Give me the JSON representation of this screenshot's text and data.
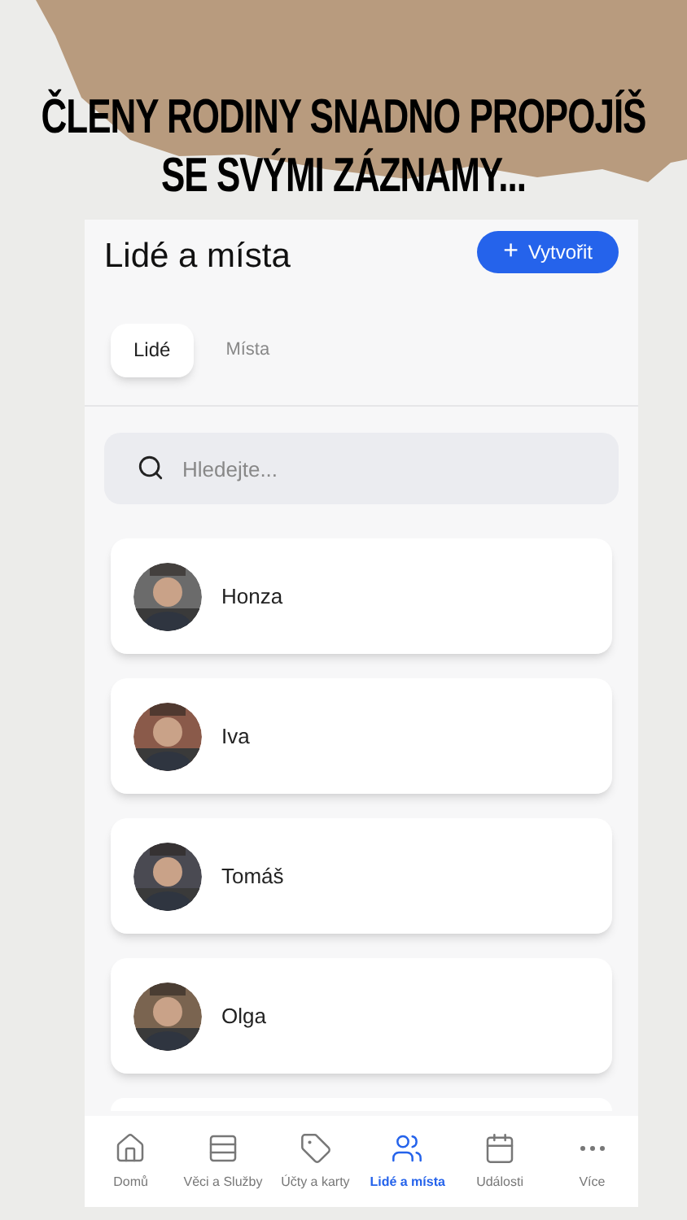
{
  "headline": [
    "ČLENY RODINY SNADNO PROPOJÍŠ",
    "SE SVÝMI ZÁZNAMY..."
  ],
  "header": {
    "title": "Lidé a místa",
    "create_button": {
      "icon": "+",
      "label": "Vytvořit"
    }
  },
  "tabs": [
    {
      "label": "Lidé",
      "selected": true
    },
    {
      "label": "Místa",
      "selected": false
    }
  ],
  "search": {
    "placeholder": "Hledejte..."
  },
  "people": [
    {
      "name": "Honza",
      "kind": "picture"
    },
    {
      "name": "Iva",
      "kind": "picture"
    },
    {
      "name": "Tomáš",
      "kind": "picture"
    },
    {
      "name": "Olga",
      "kind": "picture"
    }
  ],
  "nav": [
    {
      "label": "Domů",
      "kind": "home",
      "selected": false
    },
    {
      "label": "Věci a Služby",
      "kind": "list",
      "selected": false
    },
    {
      "label": "Účty a karty",
      "kind": "tag",
      "selected": false
    },
    {
      "label": "Lidé a místa",
      "kind": "people",
      "selected": true
    },
    {
      "label": "Události",
      "kind": "calendar",
      "selected": false
    },
    {
      "label": "Více",
      "kind": "more",
      "selected": false
    }
  ]
}
